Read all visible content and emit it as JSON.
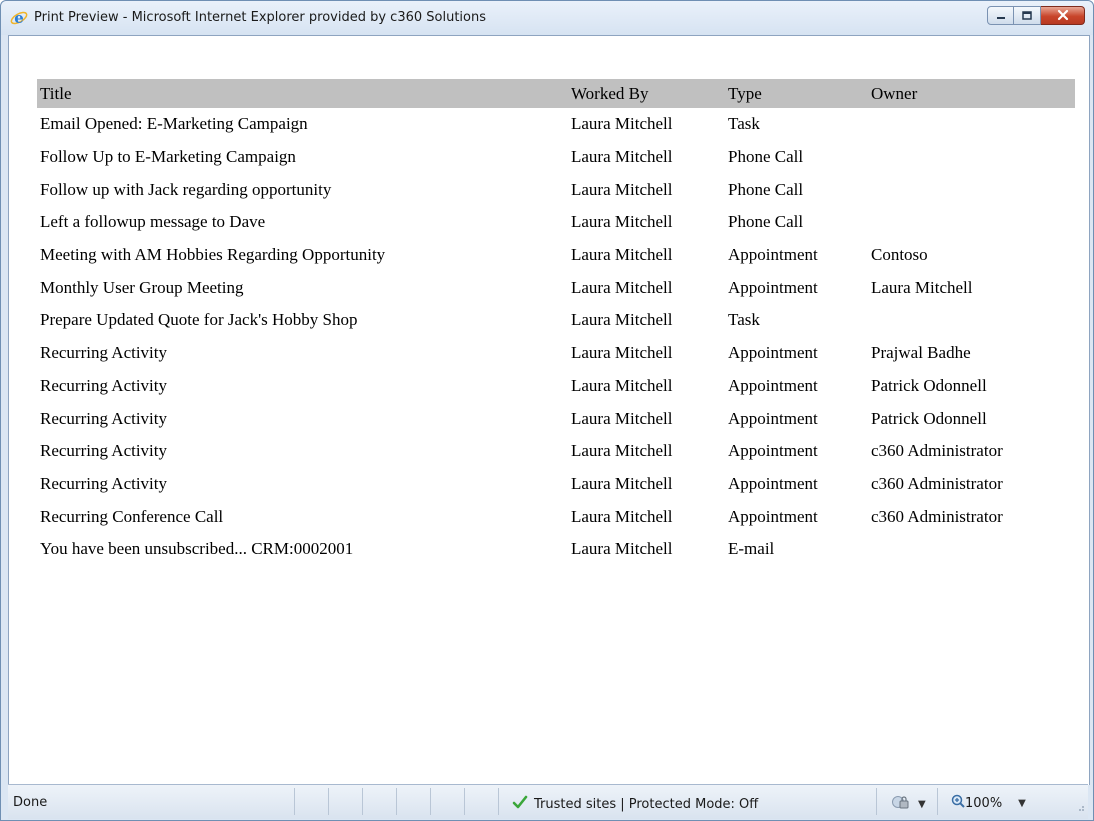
{
  "window": {
    "title": "Print Preview - Microsoft Internet Explorer provided by c360 Solutions",
    "icon": "internet-explorer-icon",
    "buttons": [
      "minimize-icon",
      "maximize-icon",
      "close-icon"
    ]
  },
  "table": {
    "headers": [
      "Title",
      "Worked By",
      "Type",
      "Owner"
    ],
    "rows": [
      [
        "Email Opened: E-Marketing Campaign",
        "Laura Mitchell",
        "Task",
        ""
      ],
      [
        "Follow Up to E-Marketing Campaign",
        "Laura Mitchell",
        "Phone Call",
        ""
      ],
      [
        "Follow up with Jack regarding opportunity",
        "Laura Mitchell",
        "Phone Call",
        ""
      ],
      [
        "Left a followup message to Dave",
        "Laura Mitchell",
        "Phone Call",
        ""
      ],
      [
        "Meeting with AM Hobbies Regarding Opportunity",
        "Laura Mitchell",
        "Appointment",
        "Contoso"
      ],
      [
        "Monthly User Group Meeting",
        "Laura Mitchell",
        "Appointment",
        "Laura Mitchell"
      ],
      [
        "Prepare Updated Quote for Jack's Hobby Shop",
        "Laura Mitchell",
        "Task",
        ""
      ],
      [
        "Recurring Activity",
        "Laura Mitchell",
        "Appointment",
        "Prajwal Badhe"
      ],
      [
        "Recurring Activity",
        "Laura Mitchell",
        "Appointment",
        "Patrick Odonnell"
      ],
      [
        "Recurring Activity",
        "Laura Mitchell",
        "Appointment",
        "Patrick Odonnell"
      ],
      [
        "Recurring Activity",
        "Laura Mitchell",
        "Appointment",
        "c360 Administrator"
      ],
      [
        "Recurring Activity",
        "Laura Mitchell",
        "Appointment",
        "c360 Administrator"
      ],
      [
        "Recurring Conference Call",
        "Laura Mitchell",
        "Appointment",
        "c360 Administrator"
      ],
      [
        "You have been unsubscribed... CRM:0002001",
        "Laura Mitchell",
        "E-mail",
        ""
      ]
    ]
  },
  "statusbar": {
    "status": "Done",
    "zone": "Trusted sites | Protected Mode: Off",
    "zoom": "100%",
    "icons": [
      "checkmark-icon",
      "security-icon",
      "zoom-icon",
      "resize-grip-icon"
    ]
  },
  "colors": {
    "header_bg": "#c0c0c0",
    "window_frame": "#dbe6f3",
    "close_button": "#c8452a",
    "zone_check": "#3aa63a"
  }
}
